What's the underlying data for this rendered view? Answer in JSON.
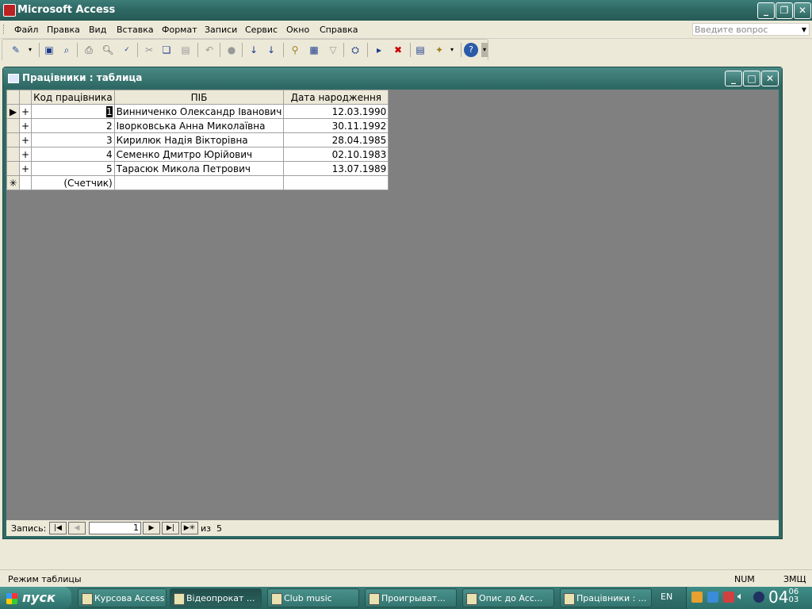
{
  "app": {
    "title": "Microsoft Access"
  },
  "menu": {
    "items": [
      "Файл",
      "Правка",
      "Вид",
      "Вставка",
      "Формат",
      "Записи",
      "Сервис",
      "Окно",
      "Справка"
    ],
    "ask_placeholder": "Введите вопрос"
  },
  "toolbar": {
    "icons": [
      "view-design-icon",
      "save-icon",
      "search-file-icon",
      "print-icon",
      "print-preview-icon",
      "spelling-icon",
      "cut-icon",
      "copy-icon",
      "paste-icon",
      "undo-icon",
      "hyperlink-icon",
      "sort-ascending-icon",
      "sort-descending-icon",
      "filter-by-selection-icon",
      "filter-by-form-icon",
      "apply-filter-icon",
      "find-icon",
      "new-record-icon",
      "delete-record-icon",
      "database-window-icon",
      "new-object-icon",
      "help-icon"
    ]
  },
  "table_window": {
    "title": "Працівники : таблица",
    "columns": [
      "Код працівника",
      "ПІБ",
      "Дата народження"
    ],
    "rows": [
      {
        "id": "1",
        "name": "Винниченко Олександр Іванович",
        "dob": "12.03.1990"
      },
      {
        "id": "2",
        "name": "Іворковська Анна Миколаївна",
        "dob": "30.11.1992"
      },
      {
        "id": "3",
        "name": "Кирилюк Надія Вікторівна",
        "dob": "28.04.1985"
      },
      {
        "id": "4",
        "name": "Семенко Дмитро Юрійович",
        "dob": "02.10.1983"
      },
      {
        "id": "5",
        "name": "Тарасюк Микола Петрович",
        "dob": "13.07.1989"
      }
    ],
    "new_row_placeholder": "(Счетчик)",
    "nav": {
      "label": "Запись:",
      "current": "1",
      "of_label": "из",
      "total": "5"
    }
  },
  "status": {
    "mode": "Режим таблицы",
    "num": "NUM",
    "lang_mode": "ЗМЩ"
  },
  "taskbar": {
    "start": "пуск",
    "buttons": [
      "Курсова Access",
      "Відеопрокат ...",
      "Club music",
      "Проигрыват...",
      "Опис до Acc...",
      "Працівники : ..."
    ],
    "lang": "EN",
    "clock_hour": "04",
    "clock_min": "06",
    "clock_sec": "03"
  }
}
